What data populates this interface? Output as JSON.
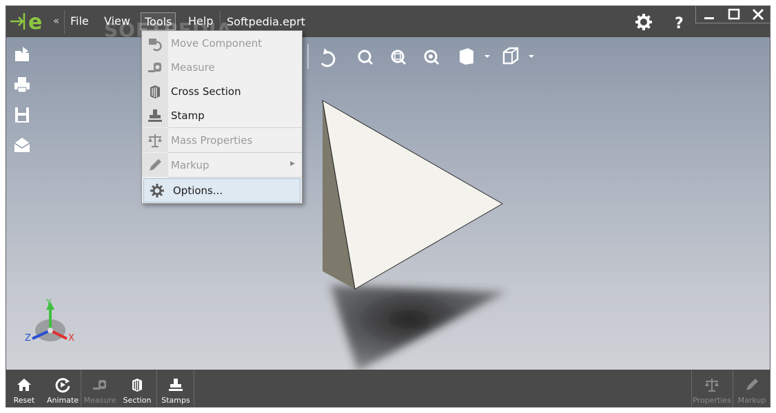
{
  "app": {
    "menus": [
      "File",
      "View",
      "Tools",
      "Help"
    ],
    "document_title": "Softpedia.eprt",
    "watermark": "SOFTPEDIA"
  },
  "tools_menu": {
    "items": [
      {
        "label": "Move Component",
        "icon": "move-component-icon",
        "enabled": false
      },
      {
        "label": "Measure",
        "icon": "measure-icon",
        "enabled": false
      },
      {
        "label": "Cross Section",
        "icon": "cross-section-icon",
        "enabled": true
      },
      {
        "label": "Stamp",
        "icon": "stamp-icon",
        "enabled": true
      },
      {
        "label": "Mass Properties",
        "icon": "mass-properties-icon",
        "enabled": false
      },
      {
        "label": "Markup",
        "icon": "pencil-icon",
        "enabled": false,
        "submenu": true
      },
      {
        "label": "Options...",
        "icon": "gear-icon",
        "enabled": true,
        "highlighted": true
      }
    ]
  },
  "axis_labels": {
    "x": "X",
    "y": "Y",
    "z": "Z"
  },
  "bottom_toolbar": {
    "reset": "Reset",
    "animate": "Animate",
    "measure": "Measure",
    "section": "Section",
    "stamps": "Stamps",
    "properties": "Properties",
    "markup": "Markup"
  },
  "colors": {
    "titlebar": "#4a4a4a",
    "logo_green": "#8dc63f",
    "highlight": "#dfe9f2"
  }
}
